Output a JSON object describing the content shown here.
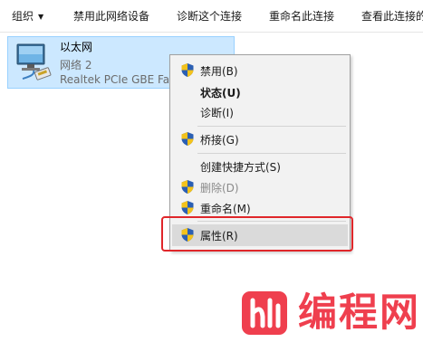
{
  "toolbar": {
    "organize": "组织",
    "disable_device": "禁用此网络设备",
    "diagnose": "诊断这个连接",
    "rename": "重命名此连接",
    "view_status": "查看此连接的"
  },
  "network_item": {
    "name": "以太网",
    "network_label": "网络  2",
    "adapter": "Realtek PCIe GBE Fam"
  },
  "context_menu": {
    "items": [
      {
        "label": "禁用(B)",
        "icon": "uac-shield-icon"
      },
      {
        "label": "状态(U)",
        "style": "bold"
      },
      {
        "label": "诊断(I)"
      },
      {
        "label": "桥接(G)",
        "icon": "uac-shield-icon"
      },
      {
        "label": "创建快捷方式(S)"
      },
      {
        "label": "删除(D)",
        "icon": "uac-shield-icon",
        "state": "disabled"
      },
      {
        "label": "重命名(M)",
        "icon": "uac-shield-icon"
      },
      {
        "label": "属性(R)",
        "icon": "uac-shield-icon",
        "state": "highlighted"
      }
    ]
  },
  "watermark": {
    "text": "编程网"
  },
  "colors": {
    "selection_bg": "#cce8ff",
    "selection_border": "#99d1ff",
    "menu_bg": "#f2f2f2",
    "highlight_red": "#e0262a",
    "watermark_red": "#ef3f4e"
  }
}
